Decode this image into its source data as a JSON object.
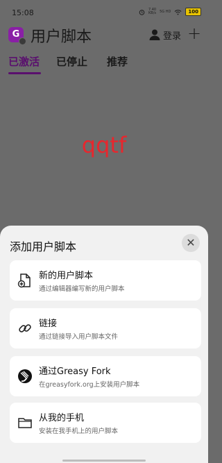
{
  "status": {
    "time": "15:08",
    "net1": "7.40",
    "net1_unit": "KB/s",
    "net2": "5G HD",
    "battery": "100"
  },
  "appbar": {
    "title": "用户脚本",
    "login": "登录",
    "plus": "+",
    "logo_letter": "G"
  },
  "tabs": [
    "已激活",
    "已停止",
    "推荐"
  ],
  "main": {
    "center_text": "qqtf"
  },
  "sheet": {
    "title": "添加用户脚本",
    "close": "✕",
    "options": [
      {
        "title": "新的用户脚本",
        "desc": "通过编辑器编写新的用户脚本",
        "icon": "new-file-icon"
      },
      {
        "title": "链接",
        "desc": "通过链接导入用户脚本文件",
        "icon": "link-icon"
      },
      {
        "title": "通过Greasy Fork",
        "desc": "在greasyfork.org上安装用户脚本",
        "icon": "greasyfork-icon"
      },
      {
        "title": "从我的手机",
        "desc": "安装在我手机上的用户脚本",
        "icon": "folder-icon"
      }
    ]
  },
  "colors": {
    "accent": "#5a0f6e",
    "logo": "#8a1fa6",
    "overlay": "#6b6b6b",
    "sheet_bg": "#f1f1f1",
    "center_text": "#e8262d"
  }
}
